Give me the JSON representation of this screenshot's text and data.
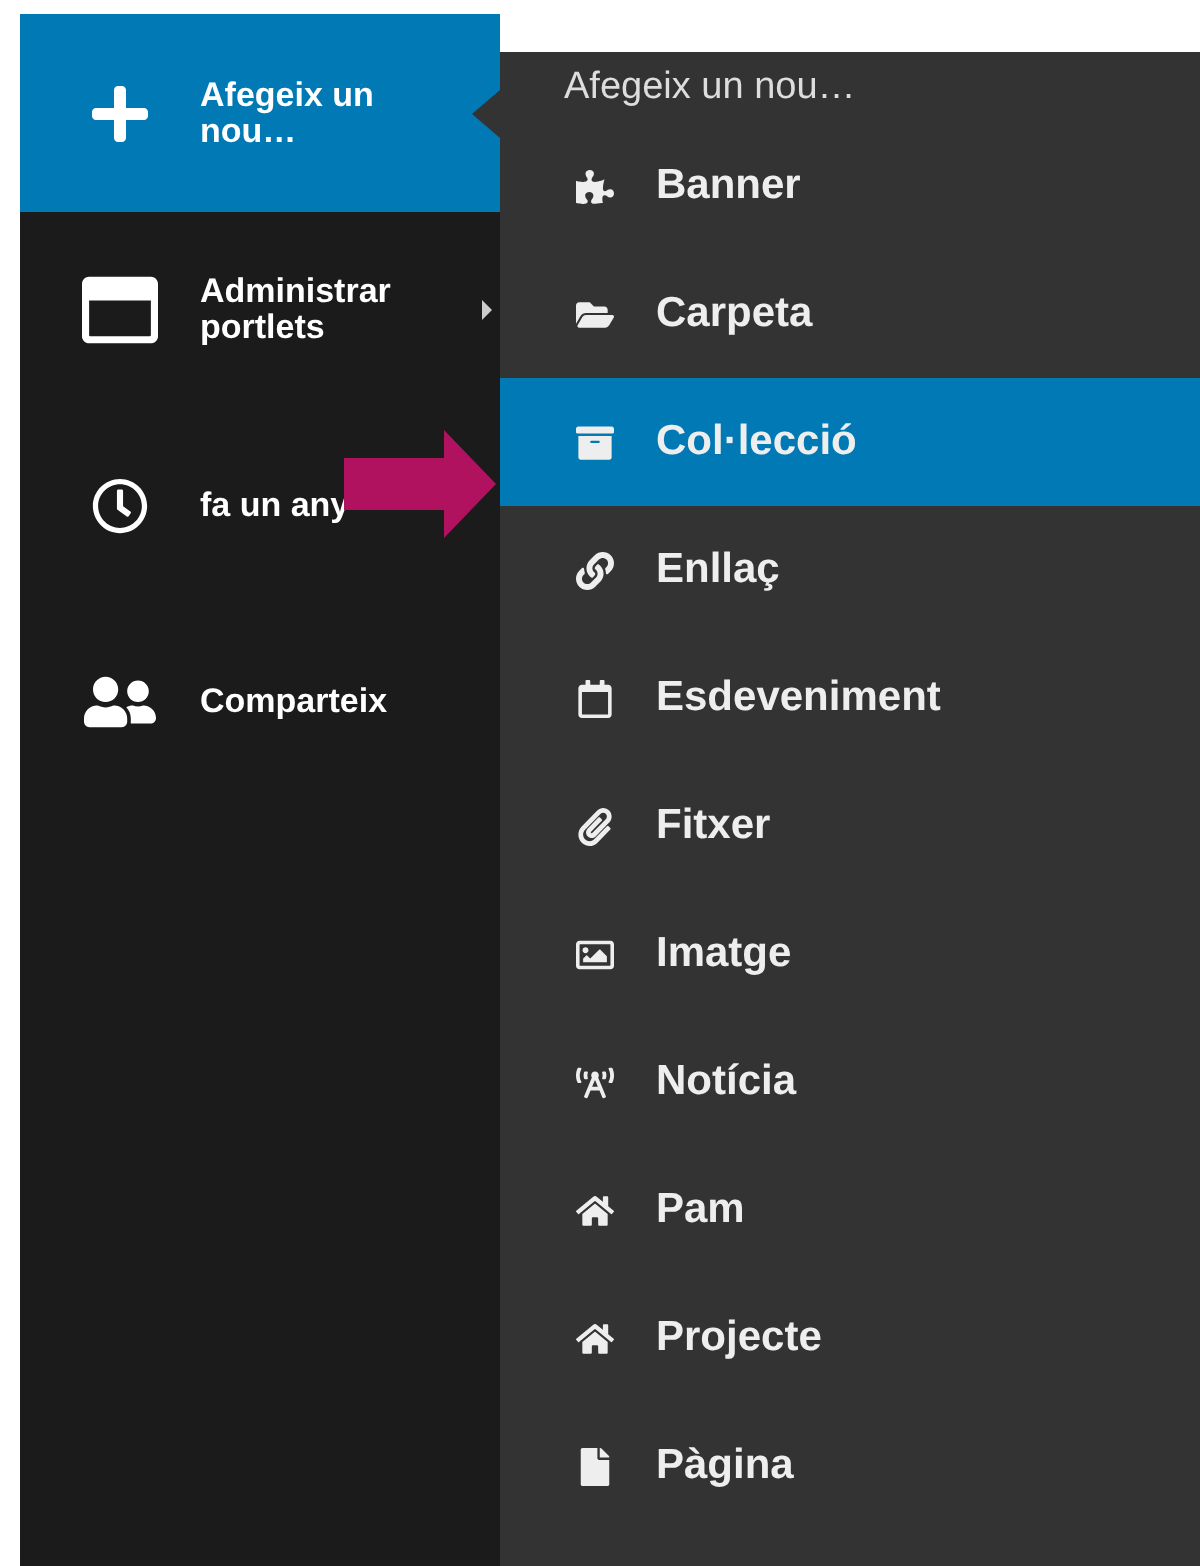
{
  "sidebar": {
    "items": [
      {
        "label": "Afegeix un nou…",
        "selected": true,
        "has_submenu": false
      },
      {
        "label": "Administrar portlets",
        "selected": false,
        "has_submenu": true
      },
      {
        "label": "fa un any",
        "selected": false,
        "has_submenu": false
      },
      {
        "label": "Comparteix",
        "selected": false,
        "has_submenu": false
      }
    ]
  },
  "submenu": {
    "title": "Afegeix un nou…",
    "items": [
      {
        "label": "Banner",
        "selected": false
      },
      {
        "label": "Carpeta",
        "selected": false
      },
      {
        "label": "Col·lecció",
        "selected": true
      },
      {
        "label": "Enllaç",
        "selected": false
      },
      {
        "label": "Esdeveniment",
        "selected": false
      },
      {
        "label": "Fitxer",
        "selected": false
      },
      {
        "label": "Imatge",
        "selected": false
      },
      {
        "label": "Notícia",
        "selected": false
      },
      {
        "label": "Pam",
        "selected": false
      },
      {
        "label": "Projecte",
        "selected": false
      },
      {
        "label": "Pàgina",
        "selected": false
      }
    ]
  }
}
